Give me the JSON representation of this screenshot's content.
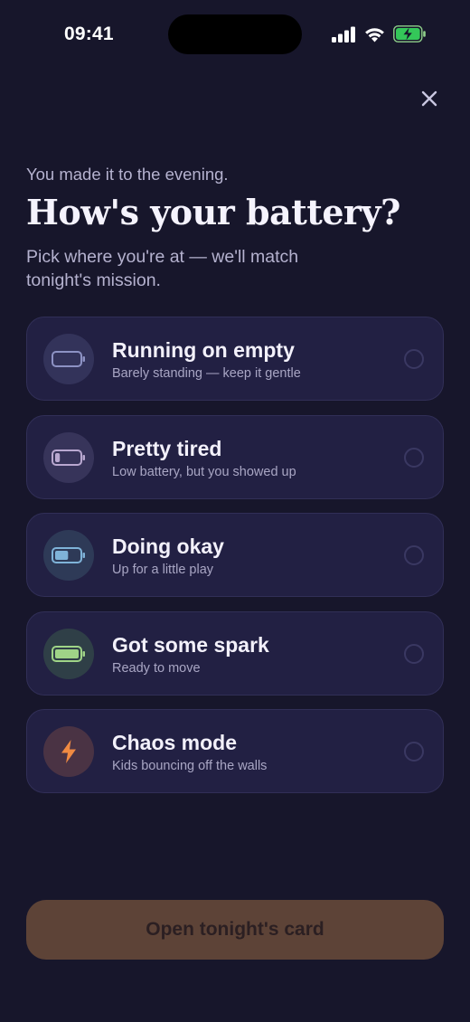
{
  "status_bar": {
    "time": "09:41"
  },
  "header": {
    "eyebrow": "You made it to the evening.",
    "title": "How's your battery?",
    "subtitle": "Pick where you're at — we'll match tonight's mission."
  },
  "options": [
    {
      "label": "Running on empty",
      "description": "Barely standing — keep it gentle",
      "icon": "battery-empty-icon",
      "level": 0.0,
      "accent": "#8d92c4",
      "icon_bg": "#33335a",
      "selected": false
    },
    {
      "label": "Pretty tired",
      "description": "Low battery, but you showed up",
      "icon": "battery-low-icon",
      "level": 0.2,
      "accent": "#b9a8d0",
      "icon_bg": "#37345a",
      "selected": false
    },
    {
      "label": "Doing okay",
      "description": "Up for a little play",
      "icon": "battery-half-icon",
      "level": 0.55,
      "accent": "#7fb3d8",
      "icon_bg": "#2e3a57",
      "selected": false
    },
    {
      "label": "Got some spark",
      "description": "Ready to move",
      "icon": "battery-full-icon",
      "level": 1.0,
      "accent": "#9fd487",
      "icon_bg": "#2f3f47",
      "selected": false
    },
    {
      "label": "Chaos mode",
      "description": "Kids bouncing off the walls",
      "icon": "lightning-bolt-icon",
      "level": null,
      "accent": "#f08a42",
      "icon_bg": "#4a3344",
      "selected": false
    }
  ],
  "cta": {
    "label": "Open tonight's card",
    "enabled": false
  }
}
